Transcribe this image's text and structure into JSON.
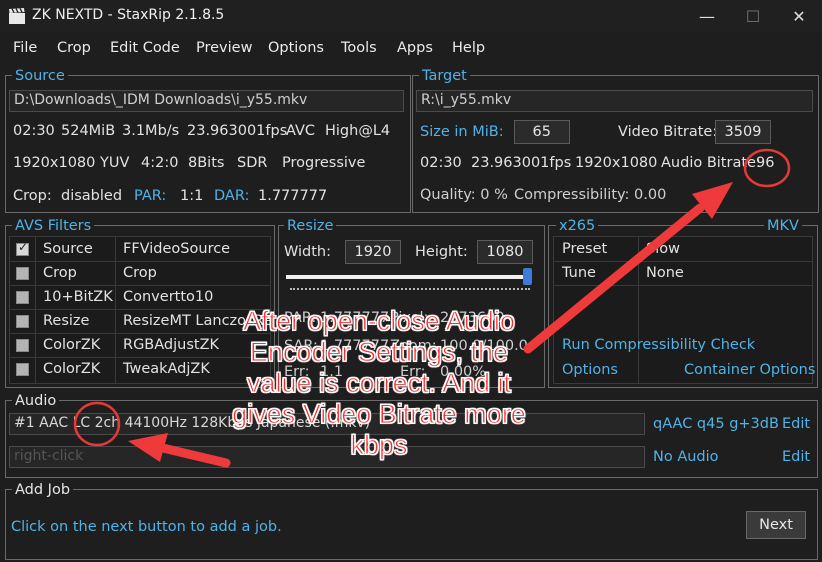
{
  "window": {
    "title": "ZK NEXTD - StaxRip 2.1.8.5",
    "minimize_glyph": "—",
    "maximize_glyph": "☐",
    "close_glyph": "✕",
    "icon": "clapperboard-icon"
  },
  "menu": [
    "File",
    "Crop",
    "Edit Code",
    "Preview",
    "Options",
    "Tools",
    "Apps",
    "Help"
  ],
  "source": {
    "title": "Source",
    "path": "D:\\Downloads\\_IDM Downloads\\i_y55.mkv",
    "row1": [
      "02:30",
      "524MiB",
      "3.1Mb/s",
      "23.963001fps",
      "AVC",
      "High@L4"
    ],
    "row2": [
      "1920x1080",
      "YUV",
      "4:2:0",
      "8Bits",
      "SDR",
      "Progressive"
    ],
    "crop_label": "Crop:",
    "crop_value": "disabled",
    "par_label": "PAR:",
    "par_value": "1:1",
    "dar_label": "DAR:",
    "dar_value": "1.777777"
  },
  "target": {
    "title": "Target",
    "path": "R:\\i_y55.mkv",
    "size_label": "Size in MiB:",
    "size_value": "65",
    "video_bitrate_label": "Video Bitrate:",
    "video_bitrate_value": "3509",
    "row": [
      "02:30",
      "23.963001fps",
      "1920x1080"
    ],
    "audio_bitrate_label": "Audio Bitrate:",
    "audio_bitrate_value": "96",
    "quality": "Quality: 0 %",
    "compressibility": "Compressibility: 0.00"
  },
  "filters": {
    "title": "AVS Filters",
    "rows": [
      {
        "name": "Source",
        "value": "FFVideoSource",
        "checked": true
      },
      {
        "name": "Crop",
        "value": "Crop",
        "checked": false
      },
      {
        "name": "10+BitZK",
        "value": "Convertto10",
        "checked": false
      },
      {
        "name": "Resize",
        "value": "ResizeMT LanczosResize",
        "checked": false
      },
      {
        "name": "ColorZK",
        "value": "RGBAdjustZK",
        "checked": false
      },
      {
        "name": "ColorZK",
        "value": "TweakAdjZK",
        "checked": false
      }
    ]
  },
  "resize": {
    "title": "Resize",
    "width_label": "Width:",
    "width_value": "1920",
    "height_label": "Height:",
    "height_value": "1080",
    "slider_level": 1.0,
    "info1a": "PAR:",
    "info1b": "1.777777",
    "info1c": "Pixel:",
    "info1d": "2073600",
    "info2a": "SAR:",
    "info2b": "1.777777",
    "info2c": "Zoom:",
    "info2d": "100.0/100.0",
    "info3a": "Err:",
    "info3b": "1.1",
    "info3c": "Err:",
    "info3d": "0.00%"
  },
  "encoder": {
    "title": "x265",
    "container_title": "MKV",
    "rows": [
      {
        "key": "Preset",
        "value": "Slow"
      },
      {
        "key": "Tune",
        "value": "None"
      }
    ],
    "check_link": "Run Compressibility Check",
    "options_link": "Options",
    "container_options_link": "Container Options"
  },
  "audio": {
    "title": "Audio",
    "track1": "#1 AAC LC 2ch 44100Hz 128Kbps Japanese (.mkv)",
    "track1_profile": "qAAC q45 g+3dB",
    "track1_edit": "Edit",
    "track2_placeholder": "right-click",
    "track2_profile": "No Audio",
    "track2_edit": "Edit"
  },
  "addjob": {
    "title": "Add Job",
    "hint": "Click on the next button to add a job.",
    "next": "Next"
  },
  "annotation": {
    "text": "After open-close Audio Encoder Settings, the value is correct. And it gives Video Bitrate more kbps",
    "color": "#ff2a2a"
  }
}
